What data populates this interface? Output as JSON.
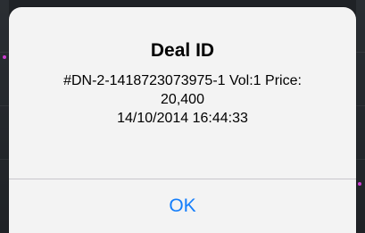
{
  "alert": {
    "title": "Deal ID",
    "message_lines": [
      "#DN-2-1418723073975-1 Vol:1 Price:",
      "20,400",
      "14/10/2014 16:44:33"
    ],
    "ok_label": "OK"
  },
  "colors": {
    "alert_background": "#f3f3f3",
    "button_text": "#147efb",
    "separator": "#c8c7cc",
    "backdrop": "#1f2226"
  }
}
